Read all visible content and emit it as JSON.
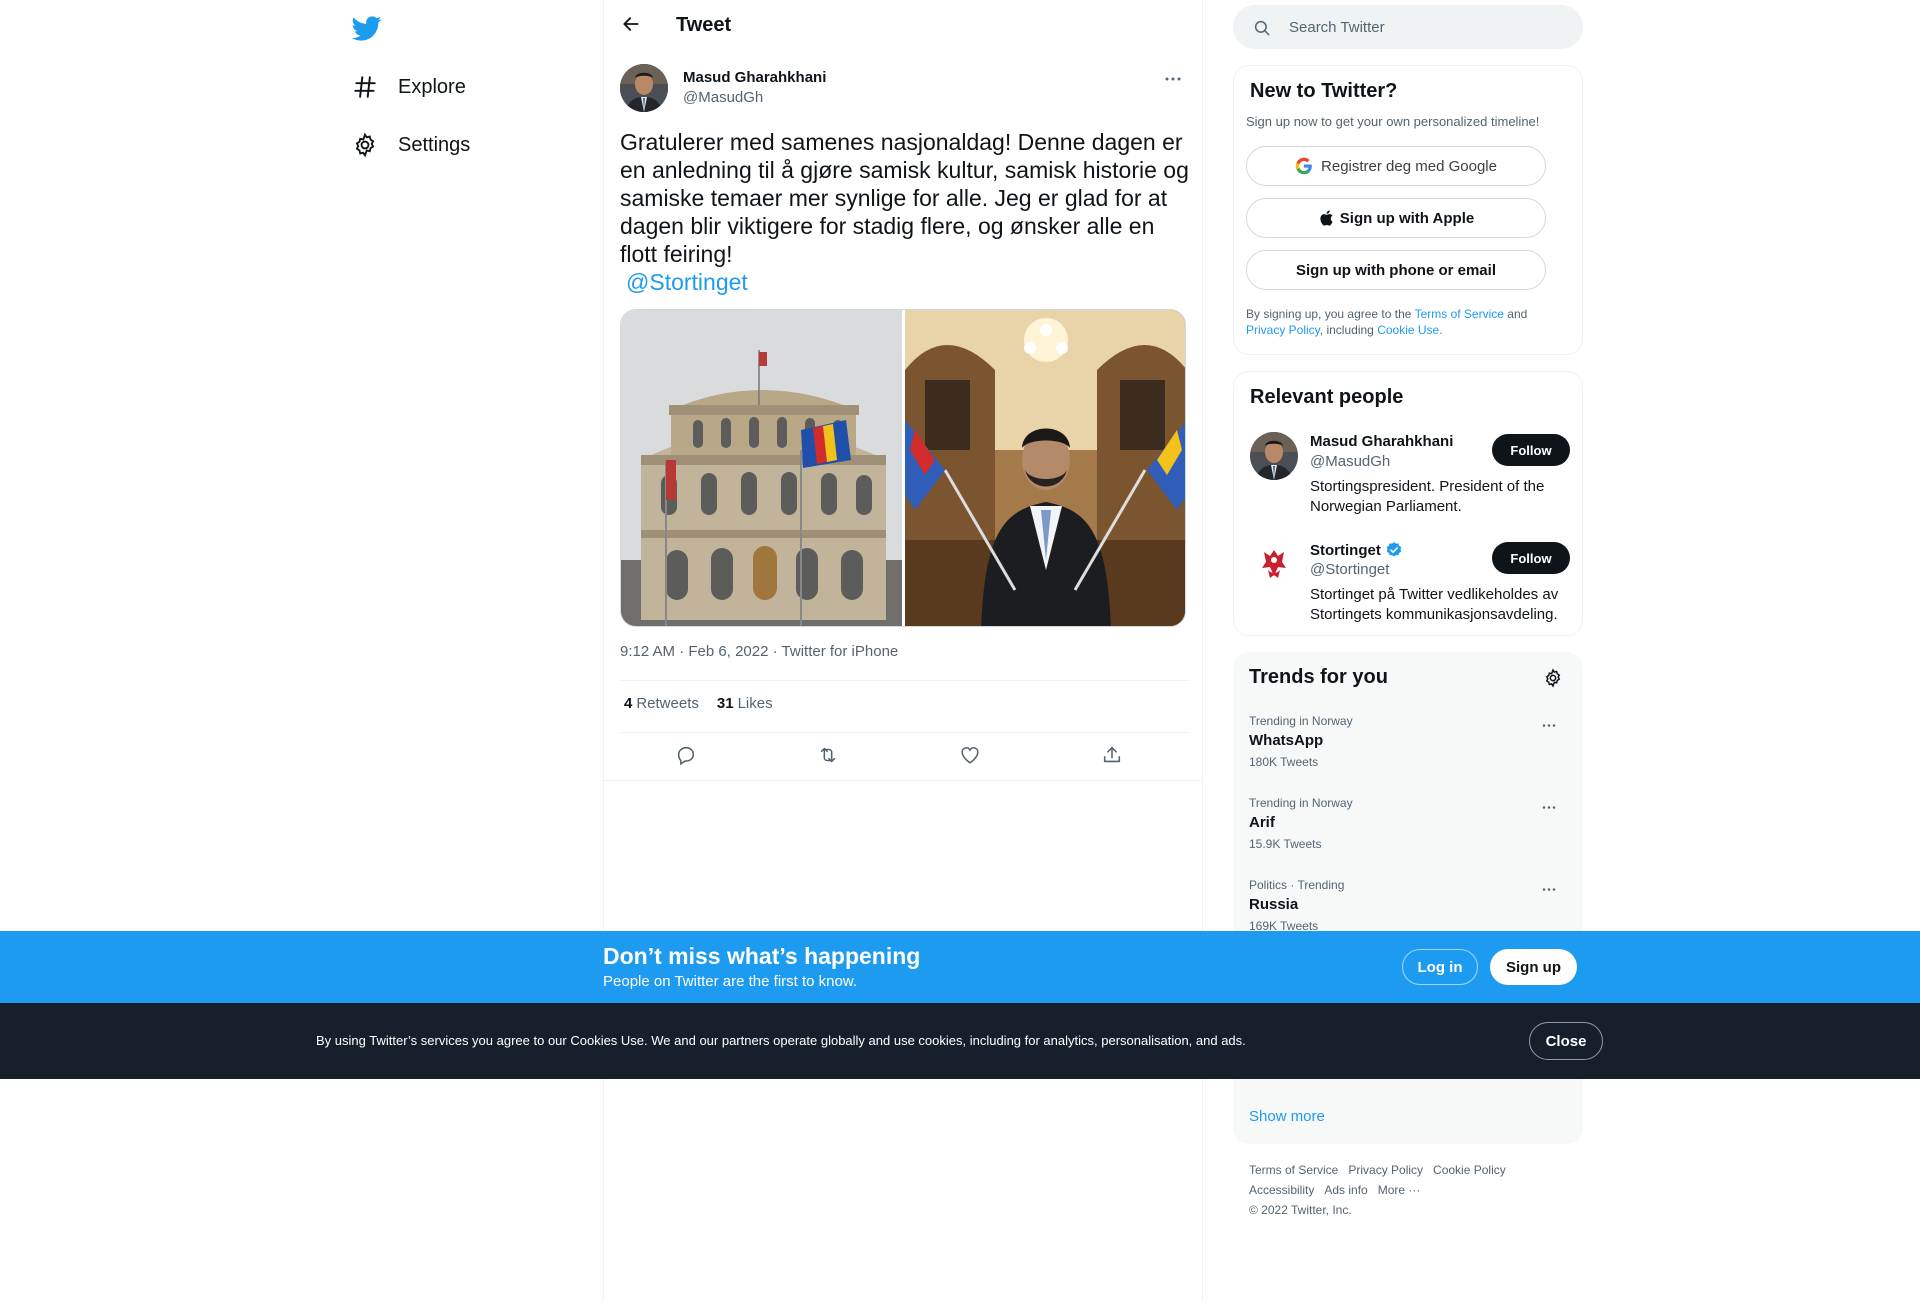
{
  "nav": {
    "logo": "twitter-bird-icon",
    "items": [
      {
        "label": "Explore",
        "icon": "hashtag-icon"
      },
      {
        "label": "Settings",
        "icon": "gear-icon"
      }
    ]
  },
  "header": {
    "title": "Tweet"
  },
  "tweet": {
    "author_name": "Masud Gharahkhani",
    "author_handle": "@MasudGh",
    "text": "Gratulerer med samenes nasjonaldag! Denne dagen er en anledning til å gjøre samisk kultur, samisk historie og samiske temaer mer synlige for alle. Jeg er glad for at dagen blir viktigere for stadig flere, og ønsker alle en flott feiring!",
    "mention": "@Stortinget",
    "time": "9:12 AM",
    "date": "Feb 6, 2022",
    "source": "Twitter for iPhone",
    "retweets_count": "4",
    "retweets_label": "Retweets",
    "likes_count": "31",
    "likes_label": "Likes"
  },
  "search": {
    "placeholder": "Search Twitter"
  },
  "signup": {
    "title": "New to Twitter?",
    "subtitle": "Sign up now to get your own personalized timeline!",
    "google_label": "Registrer deg med Google",
    "apple_label": "Sign up with Apple",
    "phone_label": "Sign up with phone or email",
    "legal_prefix": "By signing up, you agree to the",
    "terms": "Terms of Service",
    "and": "and",
    "privacy": "Privacy Policy",
    "including": ", including",
    "cookie": "Cookie Use."
  },
  "relevant": {
    "title": "Relevant people",
    "people": [
      {
        "name": "Masud Gharahkhani",
        "handle": "@MasudGh",
        "bio": "Stortingspresident. President of the Norwegian Parliament.",
        "follow": "Follow"
      },
      {
        "name": "Stortinget",
        "handle": "@Stortinget",
        "bio": "Stortinget på Twitter vedlikeholdes av Stortingets kommunikasjonsavdeling.",
        "follow": "Follow"
      }
    ]
  },
  "trends": {
    "title": "Trends for you",
    "items": [
      {
        "context": "Trending in Norway",
        "name": "WhatsApp",
        "count": "180K Tweets"
      },
      {
        "context": "Trending in Norway",
        "name": "Arif",
        "count": "15.9K Tweets"
      },
      {
        "context": "Politics · Trending",
        "name": "Russia",
        "count": "169K Tweets"
      }
    ],
    "show_more": "Show more"
  },
  "footer": {
    "links": [
      "Terms of Service",
      "Privacy Policy",
      "Cookie Policy",
      "Accessibility",
      "Ads info",
      "More ···"
    ],
    "copyright": "© 2022 Twitter, Inc."
  },
  "banner": {
    "title": "Don’t miss what’s happening",
    "subtitle": "People on Twitter are the first to know.",
    "login": "Log in",
    "signup": "Sign up"
  },
  "cookie_banner": {
    "text": "By using Twitter’s services you agree to our Cookies Use. We and our partners operate globally and use cookies, including for analytics, personalisation, and ads.",
    "close": "Close"
  },
  "colors": {
    "accent": "#1d9bf0",
    "text": "#0f1419",
    "muted": "#536471",
    "dark_banner": "#15202b"
  }
}
